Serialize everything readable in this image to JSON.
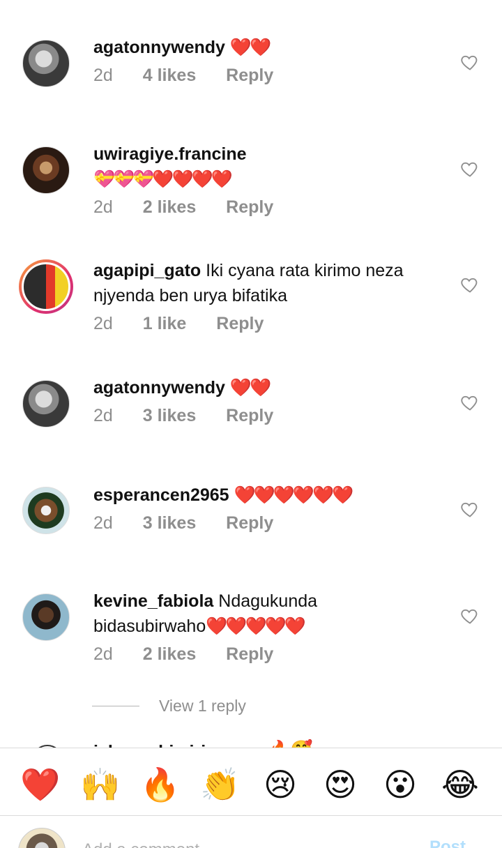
{
  "comments": [
    {
      "username": "agatonnywendy",
      "text": "",
      "emoji": "❤️❤️",
      "time": "2d",
      "likes": "4 likes",
      "reply": "Reply"
    },
    {
      "username": "uwiragiye.francine",
      "text": "",
      "emoji": "💝💝💝❤️❤️❤️❤️",
      "time": "2d",
      "likes": "2 likes",
      "reply": "Reply"
    },
    {
      "username": "agapipi_gato",
      "text": "Iki cyana rata kirimo neza",
      "text2": "njyenda ben urya bifatika",
      "emoji": "",
      "time": "2d",
      "likes": "1 like",
      "reply": "Reply"
    },
    {
      "username": "agatonnywendy",
      "text": "",
      "emoji": "❤️❤️",
      "time": "2d",
      "likes": "3 likes",
      "reply": "Reply"
    },
    {
      "username": "esperancen2965",
      "text": "",
      "emoji": "❤️❤️❤️❤️❤️❤️",
      "time": "2d",
      "likes": "3 likes",
      "reply": "Reply"
    },
    {
      "username": "kevine_fabiola",
      "text": "Ndagukunda",
      "text2": "bidasubirwaho",
      "emoji": "❤️❤️❤️❤️❤️",
      "time": "2d",
      "likes": "2 likes",
      "reply": "Reply"
    }
  ],
  "view_replies": "View 1 reply",
  "partial_comment": {
    "username": "ishanashimiriye",
    "emoji": "🔥🥰"
  },
  "emoji_bar": [
    "❤️",
    "🙌",
    "🔥",
    "👏",
    "😢",
    "😍",
    "😮",
    "😂"
  ],
  "composer": {
    "placeholder": "Add a comment...",
    "post_label": "Post"
  },
  "colors": {
    "meta": "#8e8e8e",
    "post_disabled": "#b2dffc",
    "story_ring": [
      "#f9a13a",
      "#e1306c",
      "#c13584"
    ]
  },
  "icons": {
    "like": "heart-outline-icon"
  }
}
